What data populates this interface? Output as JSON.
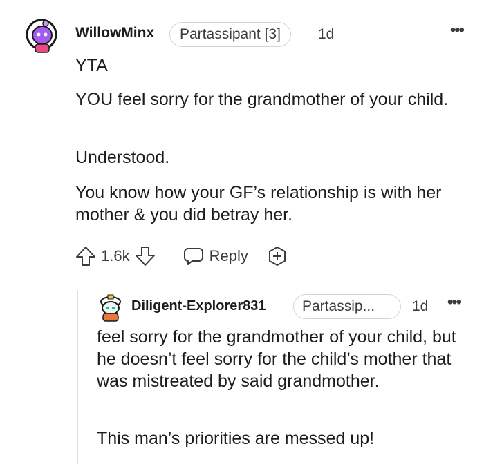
{
  "comment": {
    "username": "WillowMinx",
    "flair": "Partassipant [3]",
    "age": "1d",
    "paragraphs": [
      "YTA",
      "YOU feel sorry for the grandmother of your child.",
      "Understood.",
      "You know how your GF’s relationship is with her mother & you did betray her."
    ],
    "votes": "1.6k",
    "reply_label": "Reply",
    "icons": [
      "more-options-icon",
      "upvote-icon",
      "downvote-icon",
      "reply-icon",
      "award-icon"
    ]
  },
  "reply": {
    "username": "Diligent-Explorer831",
    "flair": "Partassip...",
    "age": "1d",
    "paragraphs": [
      "feel sorry for the grandmother of your child, but he doesn’t feel sorry for the child’s mother that was mistreated by said grandmother.",
      "This man’s priorities are messed up!"
    ]
  }
}
